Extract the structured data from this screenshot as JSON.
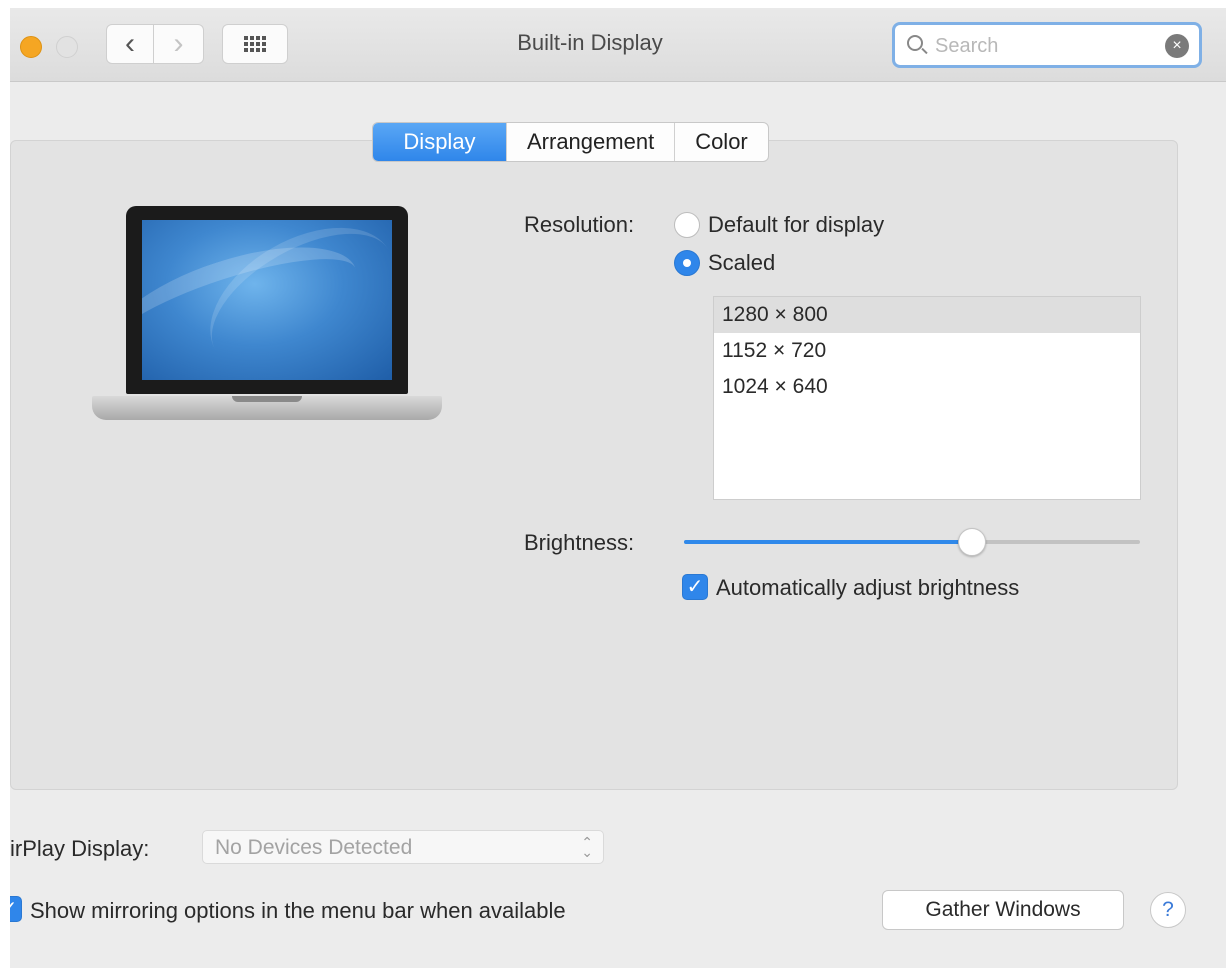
{
  "window": {
    "title": "Built-in Display",
    "nav": {
      "back_glyph": "‹",
      "forward_glyph": "›",
      "grid_icon": "show-all-grid-icon"
    },
    "search": {
      "placeholder": "Search",
      "value": ""
    }
  },
  "tabs": [
    {
      "label": "Display",
      "active": true
    },
    {
      "label": "Arrangement",
      "active": false
    },
    {
      "label": "Color",
      "active": false
    }
  ],
  "resolution": {
    "label": "Resolution:",
    "options": [
      {
        "label": "Default for display",
        "selected": false
      },
      {
        "label": "Scaled",
        "selected": true
      }
    ],
    "scaled_list": [
      {
        "label": "1280 × 800",
        "selected": true
      },
      {
        "label": "1152 × 720",
        "selected": false
      },
      {
        "label": "1024 × 640",
        "selected": false
      }
    ]
  },
  "brightness": {
    "label": "Brightness:",
    "level": 0.64,
    "auto_adjust": {
      "label": "Automatically adjust brightness",
      "checked": true
    }
  },
  "airplay": {
    "label": "irPlay Display:",
    "value": "No Devices Detected"
  },
  "mirroring": {
    "label": "Show mirroring options in the menu bar when available",
    "checked": true
  },
  "buttons": {
    "gather_windows": "Gather Windows",
    "help": "?"
  },
  "colors": {
    "accent": "#2f86ea",
    "close_button": "#f5a623",
    "search_focus_ring": "#7fb0e6"
  }
}
